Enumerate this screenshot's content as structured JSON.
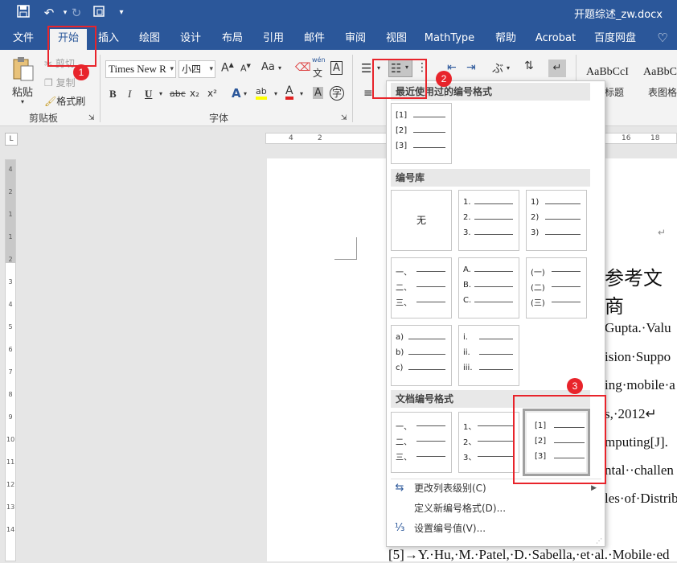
{
  "titlebar": {
    "doc_title": "开题综述_zw.docx",
    "qa_icons": [
      "save-icon",
      "undo-icon",
      "redo-icon",
      "touch-mode-icon",
      "customize-qat-icon"
    ]
  },
  "tabs": [
    "文件",
    "开始",
    "插入",
    "绘图",
    "设计",
    "布局",
    "引用",
    "邮件",
    "审阅",
    "视图",
    "MathType",
    "帮助",
    "Acrobat",
    "百度网盘"
  ],
  "active_tab": "开始",
  "clipboard": {
    "paste": "粘贴",
    "cut": "剪切",
    "copy": "复制",
    "format_painter": "格式刷",
    "group_label": "剪贴板"
  },
  "font": {
    "name": "Times New R",
    "size": "小四",
    "group_label": "字体",
    "grow": "A",
    "shrink": "A",
    "case": "Aa",
    "pinyin": "wén",
    "pinyin_char": "文",
    "border_char": "A",
    "bold": "B",
    "italic": "I",
    "underline": "U",
    "strike": "abc",
    "sub": "x₂",
    "sup": "x²",
    "effects": "A",
    "highlight": "ab",
    "color": "A",
    "shade": "A",
    "enclose": "字"
  },
  "styles": [
    {
      "sample": "AaBbCcI",
      "name": "图标题"
    },
    {
      "sample": "AaBbC",
      "name": "表图格"
    }
  ],
  "ruler_h_marks": [
    "4",
    "2",
    "16",
    "18"
  ],
  "ruler_v_marks": [
    "4",
    "2",
    "1",
    "1",
    "2",
    "3",
    "4",
    "5",
    "6",
    "7",
    "8",
    "9",
    "10",
    "11",
    "12",
    "13",
    "14"
  ],
  "dropdown": {
    "recent_header": "最近使用过的编号格式",
    "library_header": "编号库",
    "document_header": "文档编号格式",
    "none_label": "无",
    "recent_tile": [
      "[1]",
      "[2]",
      "[3]"
    ],
    "library_tiles": [
      [
        "1.",
        "2.",
        "3."
      ],
      [
        "1)",
        "2)",
        "3)"
      ],
      [
        "一、",
        "二、",
        "三、"
      ],
      [
        "A.",
        "B.",
        "C."
      ],
      [
        "(一)",
        "(二)",
        "(三)"
      ],
      [
        "a)",
        "b)",
        "c)"
      ],
      [
        "i.",
        "ii.",
        "iii."
      ]
    ],
    "document_tiles": [
      [
        "一、",
        "二、",
        "三、"
      ],
      [
        "1、",
        "2、",
        "3、"
      ],
      [
        "[1]",
        "[2]",
        "[3]"
      ]
    ],
    "menu": [
      {
        "icon": "change-list-level-icon",
        "label": "更改列表级别(C)"
      },
      {
        "icon": "",
        "label": "定义新编号格式(D)..."
      },
      {
        "icon": "set-numbering-value-icon",
        "label": "设置编号值(V)..."
      }
    ]
  },
  "document": {
    "heading": "参考文商",
    "lines": [
      "Gupta.·Valu",
      "ision·Suppo",
      "ing·mobile·a",
      "s,·2012↵",
      "mputing[J].",
      "ntal··challen",
      "les·of·Distrib",
      "[5]→Y.·Hu,·M.·Patel,·D.·Sabella,·et·al.·Mobile·ed"
    ],
    "return_mark": "↵"
  },
  "annotations": [
    "1",
    "2",
    "3"
  ]
}
